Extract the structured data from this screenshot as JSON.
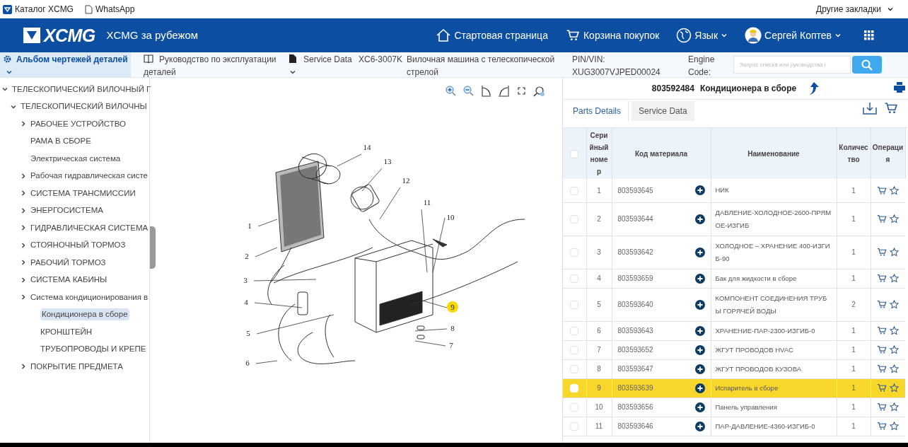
{
  "bookmarks_bar": {
    "items": [
      {
        "label": "Каталог XCMG",
        "kind": "site"
      },
      {
        "label": "WhatsApp",
        "kind": "page"
      }
    ],
    "other": "Другие закладки"
  },
  "header": {
    "logo": "XCMG",
    "title": "XCMG за рубежом",
    "nav": [
      {
        "label": "Стартовая страница",
        "kind": "home"
      },
      {
        "label": "Корзина покупок",
        "kind": "cart"
      },
      {
        "label": "Язык",
        "kind": "language"
      },
      {
        "label": "Сергей Коптев",
        "kind": "user"
      }
    ]
  },
  "subheader": {
    "album": "Альбом чертежей деталей",
    "manual": "Руководство по эксплуатации деталей",
    "service_data": "Service Data",
    "model": "XC6-3007K",
    "machine": "Вилочная машина с телескопической стрелой",
    "pin_vin_label": "PIN/VIN:",
    "pin_vin": "XUG3007VJPED00024",
    "engine_code_label": "Engine Code:",
    "search": {
      "placeholder": "Запрос списка или руководства і"
    }
  },
  "tree": [
    {
      "label": "ТЕЛЕСКОПИЧЕСКИЙ ВИЛОЧНЫЙ Г",
      "expanded": true,
      "selected": false,
      "children": [
        {
          "label": "ТЕЛЕСКОПИЧЕСКИЙ ВИЛОЧНЫ",
          "expanded": true,
          "selected": false,
          "children": [
            {
              "label": "РАБОЧЕЕ УСТРОЙСТВО",
              "expanded": false,
              "selected": false
            },
            {
              "label": "РАМА В СБОРЕ",
              "selected": false
            },
            {
              "label": "Электрическая система",
              "selected": false
            },
            {
              "label": "Рабочая гидравлическая систе",
              "expanded": false,
              "selected": false
            },
            {
              "label": "СИСТЕМА ТРАНСМИССИИ",
              "expanded": false,
              "selected": false
            },
            {
              "label": "ЭНЕРГОСИСТЕМА",
              "expanded": false,
              "selected": false
            },
            {
              "label": "ГИДРАВЛИЧЕСКАЯ СИСТЕМА",
              "expanded": false,
              "selected": false
            },
            {
              "label": "СТОЯНОЧНЫЙ ТОРМОЗ",
              "expanded": false,
              "selected": false
            },
            {
              "label": "РАБОЧИЙ ТОРМОЗ",
              "expanded": false,
              "selected": false
            },
            {
              "label": "СИСТЕМА КАБИНЫ",
              "expanded": false,
              "selected": false
            },
            {
              "label": "Система кондиционирования в",
              "expanded": false,
              "selected": false,
              "children": [
                {
                  "label": "Кондиционера в сборе",
                  "selected": true
                },
                {
                  "label": "КРОНШТЕЙН",
                  "selected": false
                },
                {
                  "label": "ТРУБОПРОВОДЫ И КРЕПЕ",
                  "selected": false
                }
              ]
            },
            {
              "label": "ПОКРЫТИЕ ПРЕДМЕТА",
              "expanded": false,
              "selected": false
            }
          ]
        }
      ]
    }
  ],
  "diagram": {
    "callouts": [
      {
        "label": "1",
        "selected": false
      },
      {
        "label": "2",
        "selected": false
      },
      {
        "label": "3",
        "selected": false
      },
      {
        "label": "4",
        "selected": false
      },
      {
        "label": "5",
        "selected": false
      },
      {
        "label": "6",
        "selected": false
      },
      {
        "label": "14",
        "selected": false
      },
      {
        "label": "13",
        "selected": false
      },
      {
        "label": "12",
        "selected": false
      },
      {
        "label": "11",
        "selected": false
      },
      {
        "label": "10",
        "selected": false
      },
      {
        "label": "9",
        "selected": true
      },
      {
        "label": "8",
        "selected": false
      },
      {
        "label": "7",
        "selected": false
      }
    ]
  },
  "parts_panel": {
    "code": "803592484",
    "title": "Кондиционера в сборе",
    "tabs": [
      {
        "label": "Parts Details",
        "selected": true
      },
      {
        "label": "Service Data",
        "selected": false
      }
    ],
    "select_all_checked": false,
    "columns": [
      "Серийный номер",
      "Код материала",
      "Наименование",
      "Количество",
      "Операция"
    ],
    "rows": [
      {
        "no": "1",
        "code": "803593645",
        "name": "НИК",
        "qty": "1",
        "selected": false
      },
      {
        "no": "2",
        "code": "803593644",
        "name": "ДАВЛЕНИЕ-ХОЛОДНОЕ-2600-ПРЯМОЕ-ИЗГИБ",
        "qty": "1",
        "selected": false
      },
      {
        "no": "3",
        "code": "803593642",
        "name": "ХОЛОДНОЕ – ХРАНЕНИЕ 400-ИЗГИБ-90",
        "qty": "1",
        "selected": false
      },
      {
        "no": "4",
        "code": "803593659",
        "name": "Бак для жидкости в сборе",
        "qty": "1",
        "selected": false
      },
      {
        "no": "5",
        "code": "803593640",
        "name": "КОМПОНЕНТ СОЕДИНЕНИЯ ТРУБЫ ГОРЯЧЕЙ ВОДЫ",
        "qty": "2",
        "selected": false
      },
      {
        "no": "6",
        "code": "803593643",
        "name": "ХРАНЕНИЕ-ПАР-2300-ИЗГИБ-0",
        "qty": "1",
        "selected": false
      },
      {
        "no": "7",
        "code": "803593652",
        "name": "ЖГУТ ПРОВОДОВ HVAC",
        "qty": "1",
        "selected": false
      },
      {
        "no": "8",
        "code": "803593647",
        "name": "ЖГУТ ПРОВОДОВ КУЗОВА",
        "qty": "1",
        "selected": false
      },
      {
        "no": "9",
        "code": "803593639",
        "name": "Испаритель в сборе",
        "qty": "1",
        "selected": true
      },
      {
        "no": "10",
        "code": "803593656",
        "name": "Панель управления",
        "qty": "1",
        "selected": false
      },
      {
        "no": "11",
        "code": "803593646",
        "name": "ПАР-ДАВЛЕНИЕ-4360-ИЗГИБ-0",
        "qty": "1",
        "selected": false
      }
    ]
  }
}
